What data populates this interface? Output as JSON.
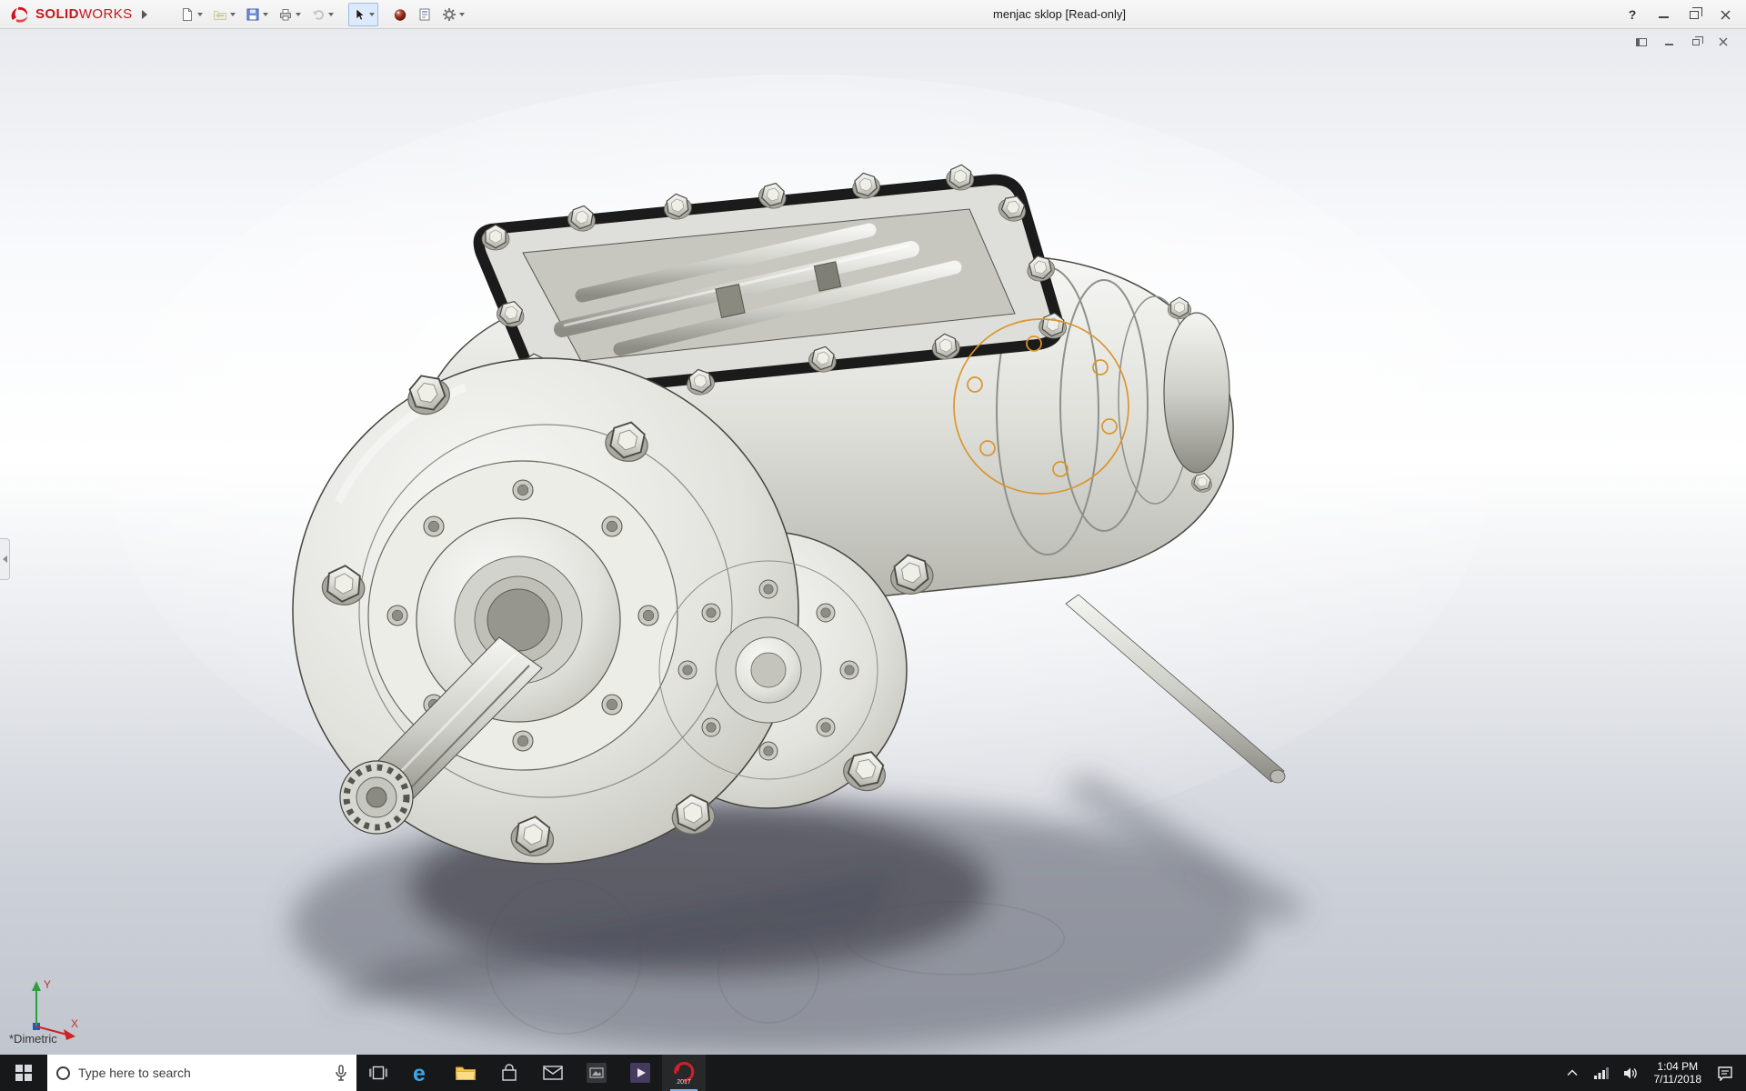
{
  "titlebar": {
    "app_name_solid": "SOLID",
    "app_name_works": "WORKS",
    "document_title": "menjac sklop [Read-only]",
    "help_glyph": "?",
    "toolbar_icons": [
      "new-document",
      "open-document",
      "save",
      "print",
      "undo",
      "select-cursor",
      "appearances-sphere",
      "file-properties",
      "options-gear"
    ],
    "window_control_icons": [
      "help-icon",
      "minimize-icon",
      "restore-icon",
      "close-icon"
    ]
  },
  "document_window": {
    "control_icons": [
      "display-pane-icon",
      "minimize-icon",
      "restore-icon",
      "close-icon"
    ]
  },
  "viewport": {
    "view_orientation_label": "*Dimetric",
    "triad": {
      "x_label": "X",
      "y_label": "Y"
    },
    "selection_highlight_color": "#d9952f",
    "model": "gearbox-assembly-3d-view"
  },
  "taskbar": {
    "search_placeholder": "Type here to search",
    "edge_glyph": "e",
    "solidworks_year_badge": "2017",
    "app_icons": [
      "start",
      "search",
      "task-view",
      "edge",
      "file-explorer",
      "store",
      "mail",
      "pinned-app-6",
      "pinned-app-7",
      "solidworks-2017"
    ],
    "tray_icons": [
      "hidden-icons-chevron",
      "network",
      "volume",
      "action-center"
    ],
    "clock": {
      "time": "1:04 PM",
      "date": "7/11/2018"
    }
  },
  "colors": {
    "solidworks_red": "#c8151e",
    "titlebar_bg": "#f1f1f1",
    "taskbar_bg": "#17181a",
    "selection_orange": "#d9952f"
  }
}
